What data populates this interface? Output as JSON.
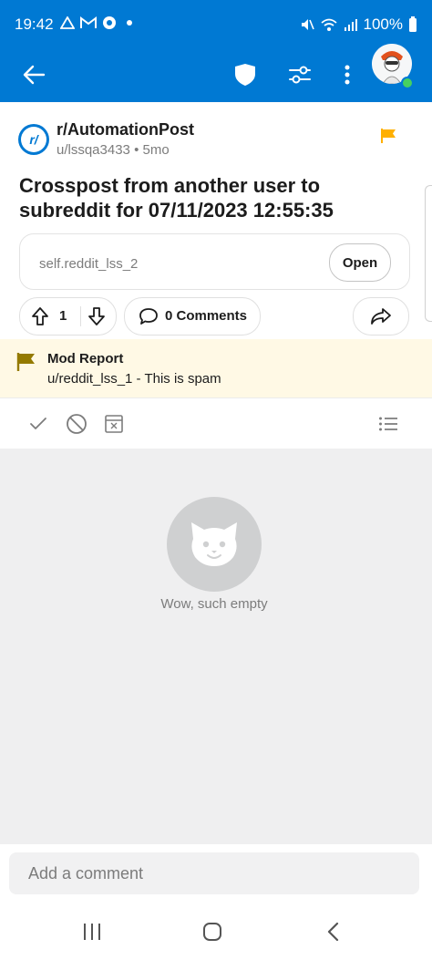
{
  "status_bar": {
    "time": "19:42",
    "battery": "100%",
    "left_icons": [
      "notification-icon",
      "gmail-icon",
      "chrome-icon",
      "dot"
    ],
    "right_icons": [
      "mute-icon",
      "wifi-icon",
      "signal-icon"
    ]
  },
  "app_bar": {
    "color": "#0079d3",
    "icons": [
      "back-arrow-icon",
      "shield-icon",
      "settings-sliders-icon",
      "more-vert-icon"
    ]
  },
  "post": {
    "subreddit": "r/AutomationPost",
    "meta": "u/lssqa3433 • 5mo",
    "title": "Crosspost from another user to subreddit for 07/11/2023 12:55:35",
    "link_text": "self.reddit_lss_2",
    "open_label": "Open",
    "vote_count": "1",
    "comments_label": "0 Comments",
    "flag_color": "#ffb000"
  },
  "mod_report": {
    "title": "Mod Report",
    "text": "u/reddit_lss_1 - This is spam",
    "background": "#fff9e5",
    "flag_color": "#947a00"
  },
  "mod_actions": {
    "icons": [
      "approve-check-icon",
      "remove-ban-icon",
      "archive-x-icon",
      "list-menu-icon"
    ]
  },
  "empty_state": {
    "text": "Wow, such empty"
  },
  "comment_box": {
    "placeholder": "Add a comment"
  },
  "nav_bar": {
    "icons": [
      "recent-apps-icon",
      "home-icon",
      "back-icon"
    ]
  }
}
